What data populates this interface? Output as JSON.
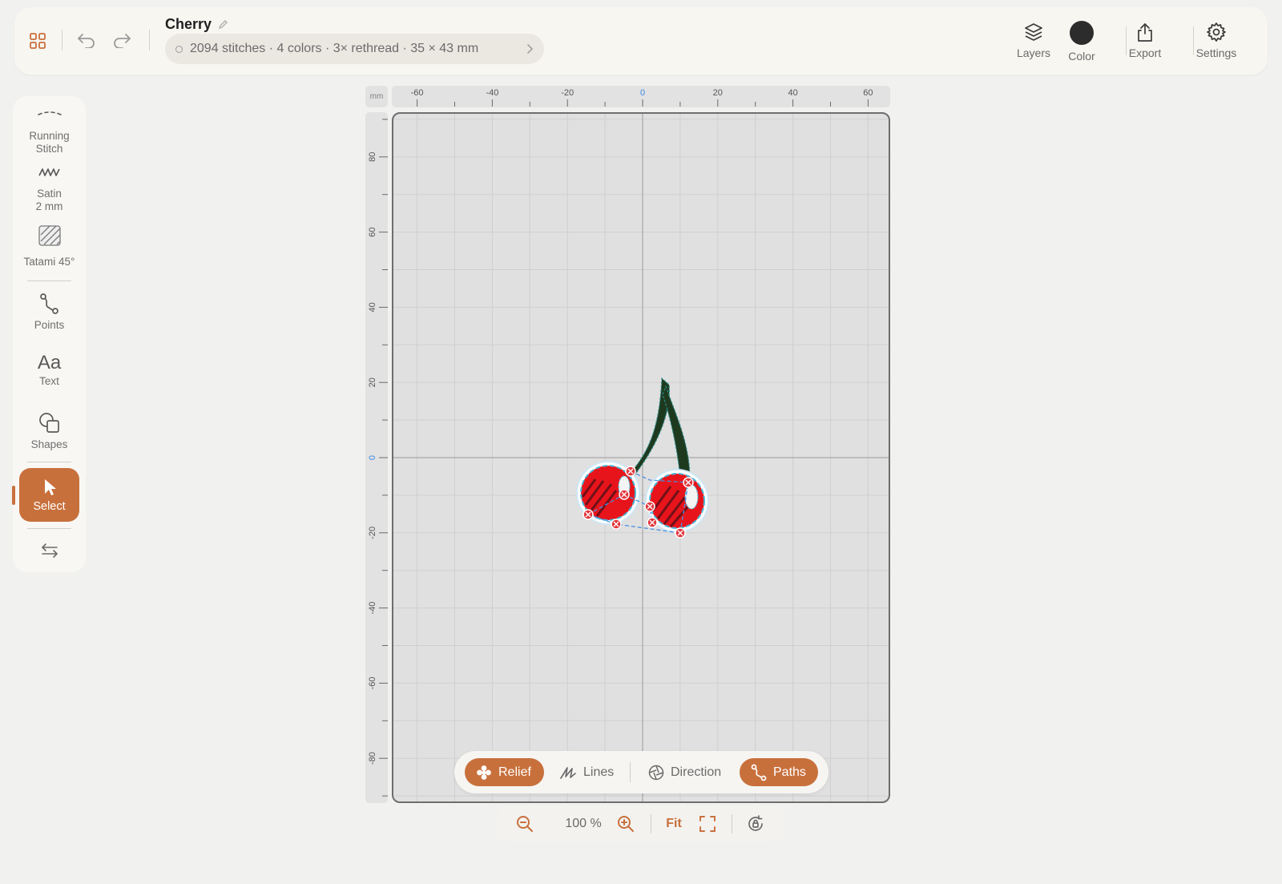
{
  "header": {
    "title": "Cherry",
    "stats": "2094 stitches · 4 colors · 3× rethread · 35 × 43 mm",
    "tools": [
      {
        "label": "Layers",
        "icon": "layers-icon"
      },
      {
        "label": "Color",
        "icon": "color-swatch"
      },
      {
        "label": "Export",
        "icon": "share-icon"
      },
      {
        "label": "Settings",
        "icon": "gear-icon"
      }
    ],
    "current_color": "#2c2c2c"
  },
  "sidebar": {
    "items": [
      {
        "label": "Running\nStitch",
        "line1": "Running",
        "line2": "Stitch"
      },
      {
        "line1": "Satin",
        "line2": "2 mm"
      },
      {
        "line1": "Tatami 45°"
      },
      {
        "line1": "Points"
      },
      {
        "line1": "Text",
        "glyph": "Aa"
      },
      {
        "line1": "Shapes"
      },
      {
        "line1": "Select"
      }
    ],
    "active": "Select"
  },
  "rulers": {
    "unit": "mm",
    "x_labels": [
      "-60",
      "-40",
      "-20",
      "0",
      "20",
      "40",
      "60"
    ],
    "y_labels": [
      "80",
      "60",
      "40",
      "20",
      "0",
      "-20",
      "-40",
      "-60",
      "-80"
    ]
  },
  "view_modes": [
    {
      "label": "Relief",
      "active": true
    },
    {
      "label": "Lines",
      "active": false
    },
    {
      "label": "Direction",
      "active": false
    },
    {
      "label": "Paths",
      "active": true
    }
  ],
  "zoom": {
    "level": "100 %",
    "fit_label": "Fit"
  },
  "colors": {
    "accent": "#c8703c",
    "cherry_red": "#e8141b",
    "stem_green": "#1e3a1e",
    "path_blue": "#4a8fe0"
  }
}
